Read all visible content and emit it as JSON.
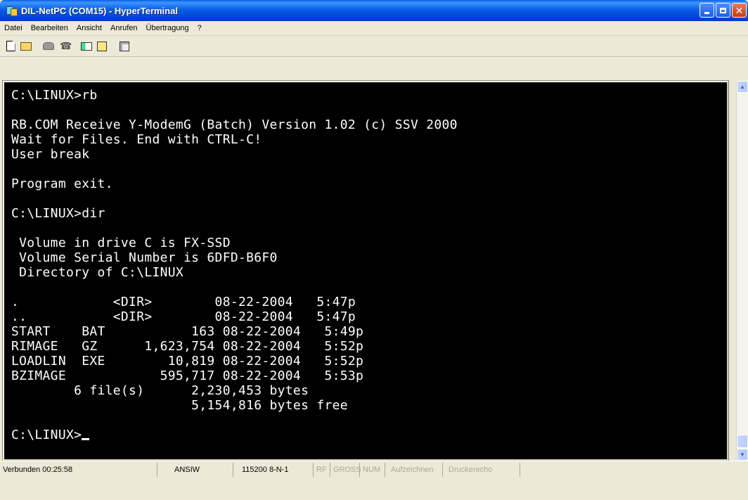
{
  "window": {
    "title": "DIL-NetPC (COM15) - HyperTerminal"
  },
  "menu": {
    "items": [
      "Datei",
      "Bearbeiten",
      "Ansicht",
      "Anrufen",
      "Übertragung",
      "?"
    ]
  },
  "toolbar": {
    "icons": [
      "new-icon",
      "open-icon",
      "call-icon",
      "disconnect-icon",
      "send-icon",
      "receive-icon",
      "properties-icon"
    ]
  },
  "terminal": {
    "lines": [
      "C:\\LINUX>rb",
      "",
      "RB.COM Receive Y-ModemG (Batch) Version 1.02 (c) SSV 2000",
      "Wait for Files. End with CTRL-C!",
      "User break",
      "",
      "Program exit.",
      "",
      "C:\\LINUX>dir",
      "",
      " Volume in drive C is FX-SSD",
      " Volume Serial Number is 6DFD-B6F0",
      " Directory of C:\\LINUX",
      "",
      ".            <DIR>        08-22-2004   5:47p",
      "..           <DIR>        08-22-2004   5:47p",
      "START    BAT           163 08-22-2004   5:49p",
      "RIMAGE   GZ      1,623,754 08-22-2004   5:52p",
      "LOADLIN  EXE        10,819 08-22-2004   5:52p",
      "BZIMAGE            595,717 08-22-2004   5:53p",
      "        6 file(s)      2,230,453 bytes",
      "                       5,154,816 bytes free",
      "",
      "C:\\LINUX>"
    ]
  },
  "status": {
    "connected": "Verbunden 00:25:58",
    "emulation": "ANSIW",
    "port_settings": "115200 8-N-1",
    "rf": "RF",
    "gross": "GROSS",
    "num": "NUM",
    "capture": "Aufzeichnen",
    "printecho": "Druckerecho"
  }
}
